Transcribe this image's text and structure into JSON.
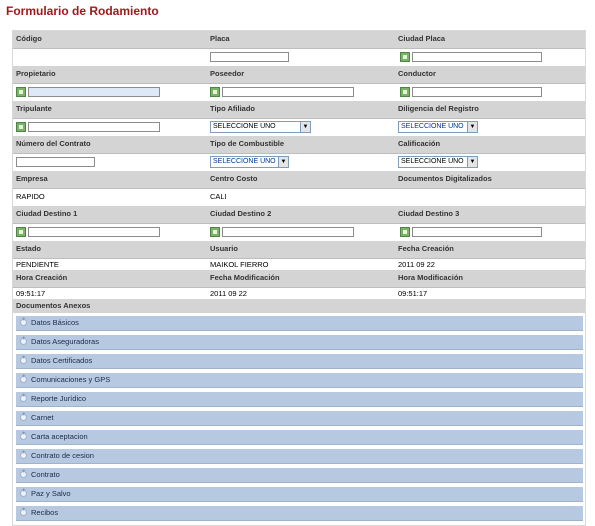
{
  "title": "Formulario de Rodamiento",
  "select_placeholder": "SELECCIONE UNO",
  "arrow": "▼",
  "rows": {
    "r1": {
      "c0": "Código",
      "c1": "Placa",
      "c2": "Ciudad Placa"
    },
    "r2": {
      "c0": "Propietario",
      "c1": "Poseedor",
      "c2": "Conductor"
    },
    "r3": {
      "c0": "Tripulante",
      "c1": "Tipo Afiliado",
      "c2": "Diligencia del Registro"
    },
    "r4": {
      "c0": "Número del Contrato",
      "c1": "Tipo de Combustible",
      "c2": "Calificación"
    },
    "r5": {
      "c0": "Empresa",
      "c1": "Centro Costo",
      "c2": "Documentos Digitalizados"
    },
    "r6": {
      "c0": "Ciudad Destino 1",
      "c1": "Ciudad Destino 2",
      "c2": "Ciudad Destino 3"
    },
    "r7": {
      "c0": "Estado",
      "c1": "Usuario",
      "c2": "Fecha Creación"
    },
    "r8": {
      "c0": "Hora Creación",
      "c1": "Fecha Modificación",
      "c2": "Hora Modificación"
    }
  },
  "values": {
    "empresa": "RAPIDO",
    "centro_costo": "CALI",
    "estado": "PENDIENTE",
    "usuario": "MAIKOL FIERRO",
    "fecha_creacion": "2011 09 22",
    "hora_creacion": "09:51:17",
    "fecha_modificacion": "2011 09 22",
    "hora_modificacion": "09:51:17"
  },
  "anexos": {
    "label": "Documentos Anexos",
    "sections": [
      "Datos Básicos",
      "Datos Aseguradoras",
      "Datos Certificados",
      "Comunicaciones y GPS",
      "Reporte Jurídico",
      "Carnet",
      "Carta aceptacion",
      "Contrato de cesion",
      "Contrato",
      "Paz y Salvo",
      "Recibos"
    ]
  },
  "colors": {
    "title": "#a3181b",
    "header_bg": "#d4d4d4",
    "section_bg": "#b7c9e0",
    "button": "#7bb26a"
  }
}
